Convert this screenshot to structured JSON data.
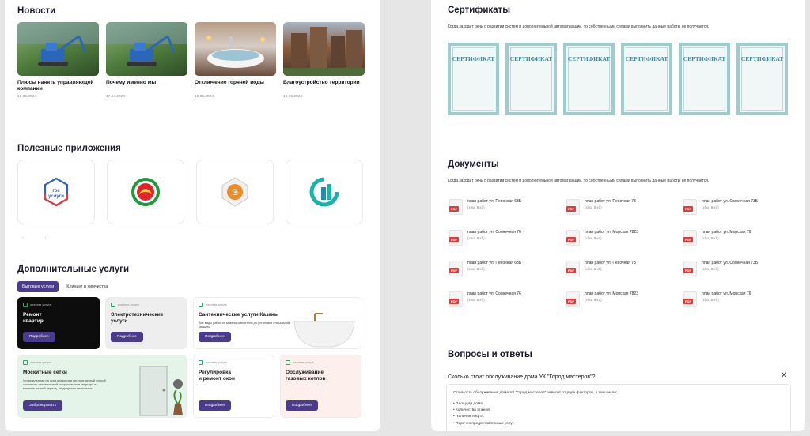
{
  "news": {
    "title": "Новости",
    "items": [
      {
        "title": "Плюсы нанять управляющей компании",
        "date": "10.05.2024"
      },
      {
        "title": "Почему именно мы",
        "date": "17.04.2024"
      },
      {
        "title": "Отключение горячей воды",
        "date": "10.05.2024"
      },
      {
        "title": "Благоустройство территории",
        "date": "10.05.2024"
      }
    ]
  },
  "apps": {
    "title": "Полезные приложения",
    "items": [
      {
        "logo_text": "гос\nуслуги",
        "icon": "gosuslugi-logo"
      },
      {
        "icon": "tatarstan-emblem-logo"
      },
      {
        "icon": "energy-logo"
      },
      {
        "icon": "city-app-logo"
      }
    ]
  },
  "services": {
    "title": "Дополнительные услуги",
    "tabs": [
      "Бытовые услуги",
      "Клининг и химчистка"
    ],
    "tagline": "платная услуга",
    "cards": [
      {
        "name": "Ремонт\nквартир",
        "button": "Подробнее"
      },
      {
        "name": "Электротехнические\nуслуги",
        "button": "Подробнее"
      },
      {
        "name": "Сантехнические услуги Казань",
        "desc": "Все виды работ от замены смесителя до установки стиральной машины",
        "button": "Подробнее"
      },
      {
        "name": "Москитные сетки",
        "desc": "Установленная на окна москитная сетка отличный способ сохранить оптимальный микроклимат в квартире в весенне-летний период, не допуская насекомых.",
        "button": "Забронировать"
      },
      {
        "name": "Регулировка\nи ремонт окон",
        "button": "Подробнее"
      },
      {
        "name": "Обслуживание\nгазовых котлов",
        "button": "Подробнее"
      }
    ]
  },
  "certificates": {
    "title": "Сертификаты",
    "subtitle": "Когда заходит речь о развитии систем и дополнительной автоматизации, то собственными силами выполнить данные работы не получается.",
    "items": [
      "СЕРТИФИКАТ",
      "СЕРТИФИКАТ",
      "СЕРТИФИКАТ",
      "СЕРТИФИКАТ",
      "СЕРТИФИКАТ",
      "СЕРТИФИКАТ"
    ]
  },
  "documents": {
    "title": "Документы",
    "subtitle": "Когда заходит речь о развитии систем и дополнительной автоматизации, то собственными силами выполнить данные работы не получается.",
    "badge": "PDF",
    "items": [
      {
        "name": "план работ ул. Песочная 63Б",
        "meta": "(xlsx, 8 кб)"
      },
      {
        "name": "план работ ул. Песочная 73",
        "meta": "(xlsx, 8 кб)"
      },
      {
        "name": "план работ ул. Солнечная 73Б",
        "meta": "(xlsx, 8 кб)"
      },
      {
        "name": "план работ ул. Солнечная 76",
        "meta": "(xlsx, 8 кб)"
      },
      {
        "name": "план работ ул. Морская 7823",
        "meta": "(xlsx, 8 кб)"
      },
      {
        "name": "план работ ул. Морская 76",
        "meta": "(xlsx, 8 кб)"
      },
      {
        "name": "план работ ул. Песочная 63Б",
        "meta": "(xlsx, 8 кб)"
      },
      {
        "name": "план работ ул. Песочная 73",
        "meta": "(xlsx, 8 кб)"
      },
      {
        "name": "план работ ул. Солнечная 73Б",
        "meta": "(xlsx, 8 кб)"
      },
      {
        "name": "план работ ул. Солнечная 76",
        "meta": "(xlsx, 8 кб)"
      },
      {
        "name": "план работ ул. Морская 7823",
        "meta": "(xlsx, 8 кб)"
      },
      {
        "name": "план работ ул. Морская 76",
        "meta": "(xlsx, 8 кб)"
      }
    ]
  },
  "faq": {
    "title": "Вопросы и ответы",
    "question": "Сколько стоит обслуживание дома УК \"Город мастеров\"?",
    "answer": "Стоимость обслуживания дома УК \"Город мастеров\" зависит от ряда факторов, в том числе:",
    "list": [
      "• Площади дома.",
      "• Количества этажей.",
      "• Наличия лифта.",
      "• Перечня предоставляемых услуг."
    ],
    "close": "✕"
  }
}
